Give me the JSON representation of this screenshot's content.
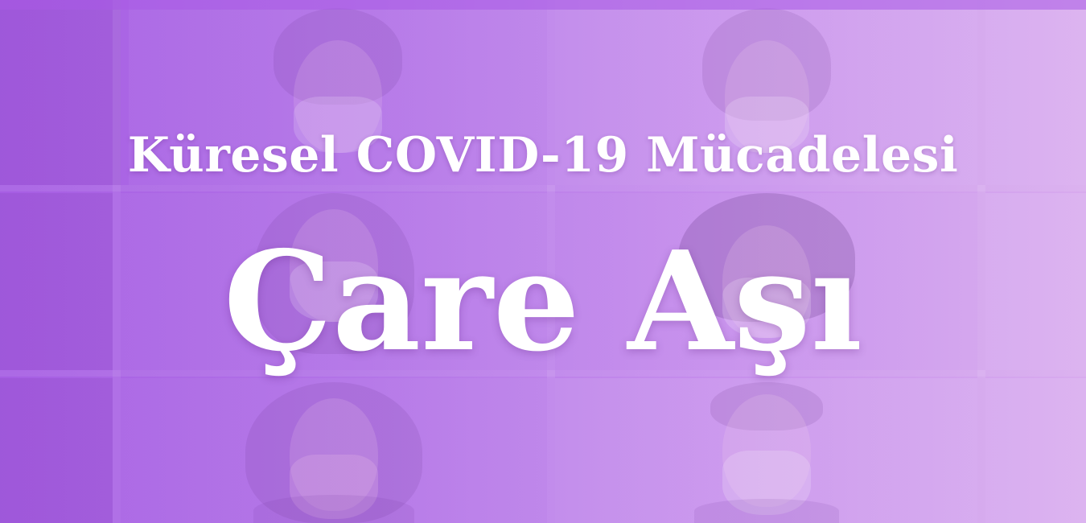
{
  "banner": {
    "subtitle": "Küresel COVID-19 Mücadelesi",
    "headline": "Çare Aşı"
  },
  "colors": {
    "background_left": "#a862e4",
    "background_right": "#d7aaee",
    "text": "#ffffff"
  }
}
